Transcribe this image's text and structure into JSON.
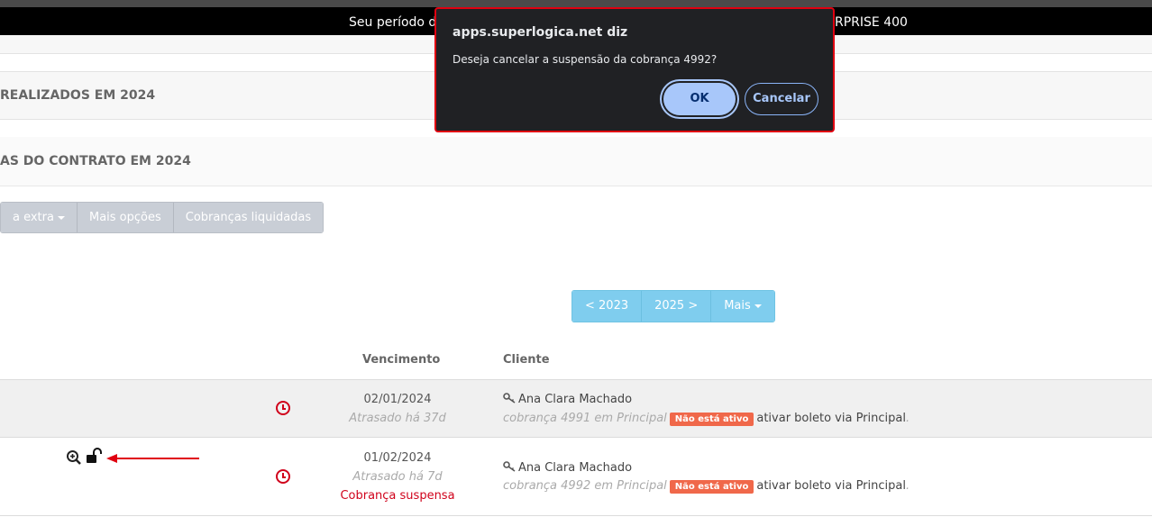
{
  "banner": {
    "text_left": "Seu período de",
    "text_right": "RPRISE 400"
  },
  "panels": {
    "realizados_title": "REALIZADOS EM 2024",
    "contrato_title": "AS DO CONTRATO EM 2024"
  },
  "toolbar": {
    "buttons": [
      {
        "label": "a extra",
        "has_caret": true
      },
      {
        "label": "Mais opções",
        "has_caret": false
      },
      {
        "label": "Cobranças liquidadas",
        "has_caret": false
      }
    ]
  },
  "year_nav": {
    "prev": "< 2023",
    "next": "2025 >",
    "more": "Mais"
  },
  "table": {
    "headers": {
      "vencimento": "Vencimento",
      "cliente": "Cliente"
    },
    "rows": [
      {
        "date": "02/01/2024",
        "late": "Atrasado há 37d",
        "status": "",
        "client": "Ana Clara Machado",
        "charge": "cobrança 4991 em Principal",
        "badge": "Não está ativo",
        "action": "ativar boleto via Principal",
        "action_suffix": "."
      },
      {
        "date": "01/02/2024",
        "late": "Atrasado há 7d",
        "status": "Cobrança suspensa",
        "client": "Ana Clara Machado",
        "charge": "cobrança 4992 em Principal",
        "badge": "Não está ativo",
        "action": "ativar boleto via Principal",
        "action_suffix": "."
      }
    ]
  },
  "dialog": {
    "title": "apps.superlogica.net diz",
    "message": "Deseja cancelar a suspensão da cobrança 4992?",
    "ok_label": "OK",
    "cancel_label": "Cancelar"
  },
  "colors": {
    "alert_red": "#d0021b",
    "badge_orange": "#f0684a",
    "year_nav_blue": "#7fcdee",
    "dialog_bg": "#202124",
    "ok_button": "#a8c7fa"
  },
  "icons": {
    "row_clock": "clock-icon",
    "client_key": "key-icon",
    "zoom": "magnifier-plus-icon",
    "unlock": "unlocked-padlock-icon",
    "annotation": "red-arrow-annotation"
  }
}
